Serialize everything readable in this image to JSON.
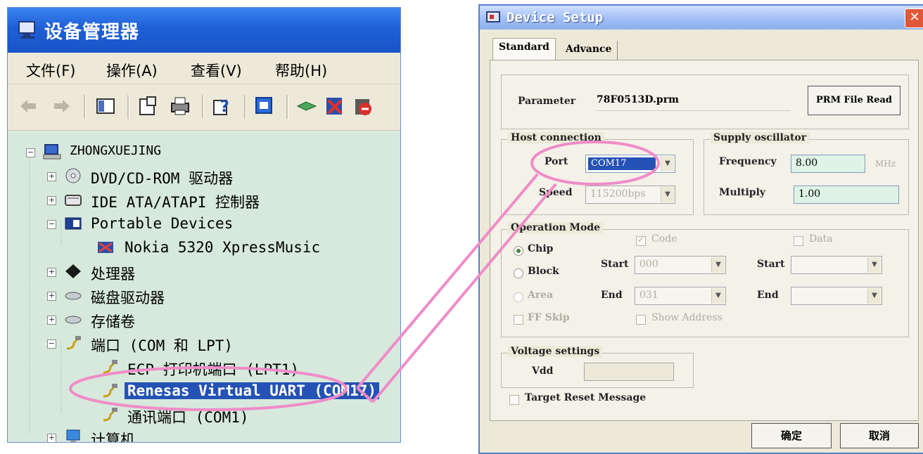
{
  "device_manager": {
    "title": "设备管理器",
    "menu": [
      "文件(F)",
      "操作(A)",
      "查看(V)",
      "帮助(H)"
    ],
    "tree": {
      "root": "ZHONGXUEJING",
      "items": [
        "DVD/CD-ROM 驱动器",
        "IDE ATA/ATAPI 控制器",
        "Portable Devices",
        "Nokia 5320 XpressMusic",
        "处理器",
        "磁盘驱动器",
        "存储卷",
        "端口 (COM 和 LPT)",
        "ECP 打印机端口 (LPT1)",
        "Renesas Virtual UART (COM17)",
        "通讯端口 (COM1)",
        "计算机"
      ]
    }
  },
  "device_setup": {
    "title": "Device Setup",
    "tabs": [
      "Standard",
      "Advance"
    ],
    "parameter_label": "Parameter",
    "parameter_value": "78F0513D.prm",
    "prm_button": "PRM File Read",
    "host_connection": {
      "label": "Host connection",
      "port_label": "Port",
      "port_value": "COM17",
      "speed_label": "Speed",
      "speed_value": "115200bps"
    },
    "supply_oscillator": {
      "label": "Supply oscillator",
      "frequency_label": "Frequency",
      "frequency_value": "8.00",
      "frequency_unit": "MHz",
      "multiply_label": "Multiply",
      "multiply_value": "1.00"
    },
    "operation_mode": {
      "label": "Operation Mode",
      "chip": "Chip",
      "block": "Block",
      "area": "Area",
      "ff_skip": "FF Skip",
      "code": "Code",
      "data": "Data",
      "start_label": "Start",
      "start_value": "000",
      "end_label": "End",
      "end_value": "031",
      "start2_label": "Start",
      "end2_label": "End",
      "show_address": "Show Address"
    },
    "voltage": {
      "label": "Voltage settings",
      "vdd_label": "Vdd"
    },
    "target_reset": "Target Reset Message",
    "ok_button": "确定",
    "cancel_button": "取消"
  },
  "colors": {
    "annotation": "#f08cc8",
    "selection": "#2452b5",
    "tree_bg": "#d6e9dc"
  }
}
